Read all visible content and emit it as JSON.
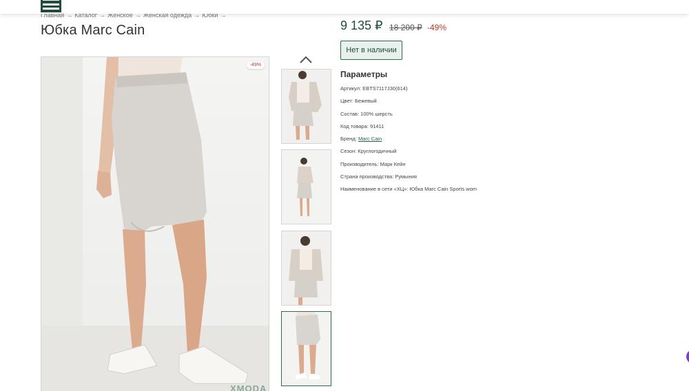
{
  "header": {
    "menu_icon": "hamburger-menu-icon",
    "accent_color": "#1e4d3c"
  },
  "breadcrumb": [
    {
      "label": "Главная"
    },
    {
      "label": "Каталог"
    },
    {
      "label": "Женское"
    },
    {
      "label": "Женская одежда"
    },
    {
      "label": "Юбки"
    }
  ],
  "breadcrumb_separator": "→",
  "product": {
    "title": "Юбка Marc Cain",
    "discount_badge": "-49%",
    "watermark": "ХМODA",
    "price_current": "9 135 ₽",
    "price_old": "18 200 ₽",
    "price_discount": "-49%",
    "stock_button": "Нет в наличии",
    "params_title": "Параметры",
    "params": [
      {
        "label": "Артикул:",
        "value": "EBTS7117J30(614)"
      },
      {
        "label": "Цвет:",
        "value": "Бежевый"
      },
      {
        "label": "Состав:",
        "value": "100% шерсть"
      },
      {
        "label": "Код товара:",
        "value": "91411"
      },
      {
        "label": "Бренд:",
        "value": "Marc Cain",
        "link": true
      },
      {
        "label": "Сезон:",
        "value": "Круглогодичный"
      },
      {
        "label": "Производитель:",
        "value": "Марк Кейн"
      },
      {
        "label": "Страна производства:",
        "value": "Румыния"
      },
      {
        "label": "Наименование в сети «ХЦ»:",
        "value": "Юбка Marc Cain Sports wom"
      }
    ]
  },
  "thumbnails": {
    "up_icon": "chevron-up-icon",
    "items": [
      {
        "name": "thumb-1",
        "active": false
      },
      {
        "name": "thumb-2",
        "active": false
      },
      {
        "name": "thumb-3",
        "active": false
      },
      {
        "name": "thumb-4",
        "active": true
      }
    ]
  },
  "colors": {
    "price_green": "#1e4d3c",
    "discount_red": "#c0392b",
    "skirt_beige": "#d8d4cf"
  }
}
